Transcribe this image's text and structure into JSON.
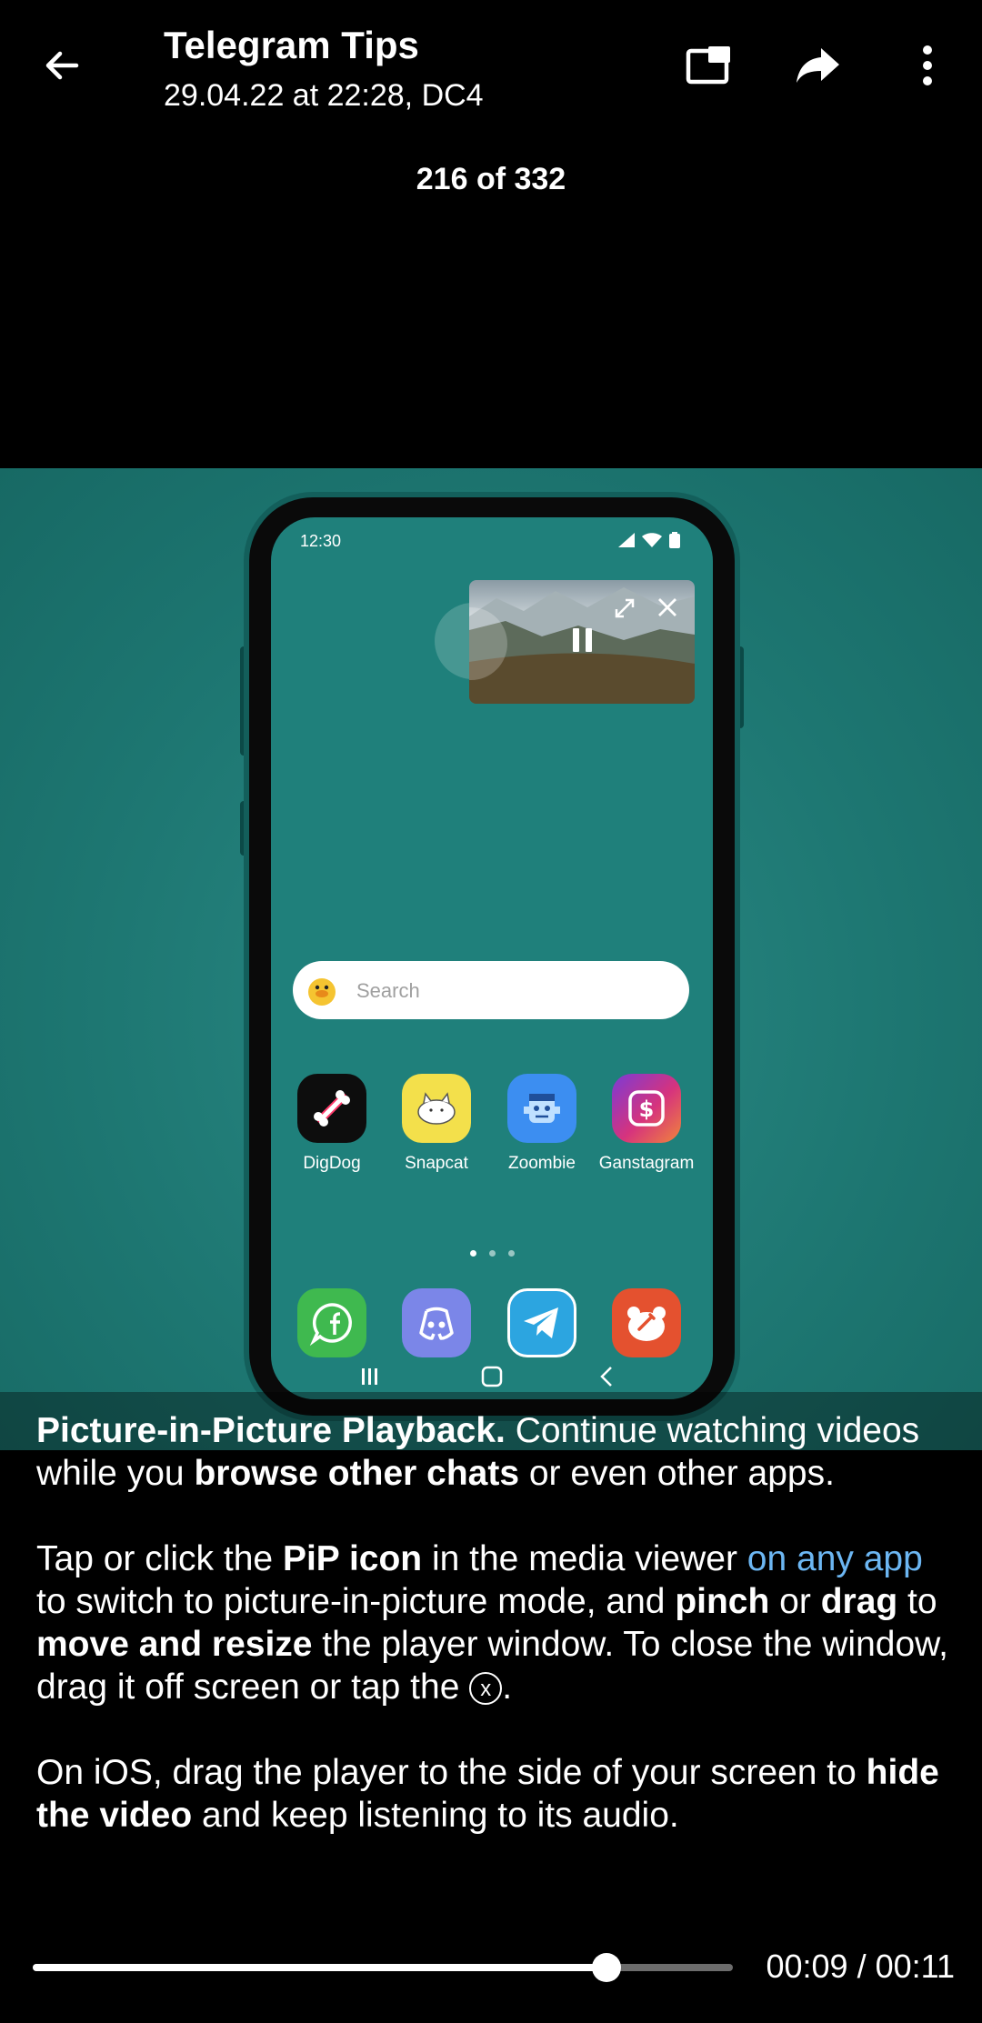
{
  "header": {
    "title": "Telegram Tips",
    "subtitle": "29.04.22 at 22:28, DC4",
    "counter": "216 of 332",
    "icons": [
      "back-arrow-icon",
      "pip-icon",
      "forward-icon",
      "more-vertical-icon"
    ]
  },
  "video": {
    "status_time": "12:30",
    "search_placeholder": "Search",
    "apps": [
      {
        "label": "DigDog",
        "icon": "bone-icon",
        "color": "#0d0d0d"
      },
      {
        "label": "Snapcat",
        "icon": "cat-icon",
        "color": "#f3e04b"
      },
      {
        "label": "Zoombie",
        "icon": "zombie-icon",
        "color": "#3c8ef1"
      },
      {
        "label": "Ganstagram",
        "icon": "dollar-icon",
        "color": "#c33a8d"
      }
    ],
    "dock": [
      {
        "icon": "facebook-chat-icon",
        "color": "#3fb94f"
      },
      {
        "icon": "discord-icon",
        "color": "#7b86e8"
      },
      {
        "icon": "telegram-icon",
        "color": "#2ca5e0"
      },
      {
        "icon": "bear-icon",
        "color": "#e4512f"
      }
    ]
  },
  "caption": {
    "p1_bold": "Picture-in-Picture Playback.",
    "p1_a": " Continue watching videos while you ",
    "p1_bold2": "browse other chats",
    "p1_b": " or even other apps.",
    "p2_a": "Tap or click the ",
    "p2_bold1": "PiP icon",
    "p2_b": " in the media viewer ",
    "p2_link": "on any app",
    "p2_c": " to switch to picture-in-picture mode, and ",
    "p2_bold2": "pinch",
    "p2_d": " or ",
    "p2_bold3": "drag",
    "p2_e": " to ",
    "p2_bold4": "move and resize",
    "p2_f": " the player window. To close the window, drag it off screen or tap the ",
    "p2_x": "x",
    "p2_g": ".",
    "p3_a": "On iOS, drag the player to the side of your screen to ",
    "p3_bold": "hide the video",
    "p3_b": " and keep listening to its audio."
  },
  "player": {
    "progress": 0.82,
    "time": "00:09 / 00:11"
  },
  "colors": {
    "link": "#6cb6f2",
    "video_bg": "#1f7d78"
  }
}
